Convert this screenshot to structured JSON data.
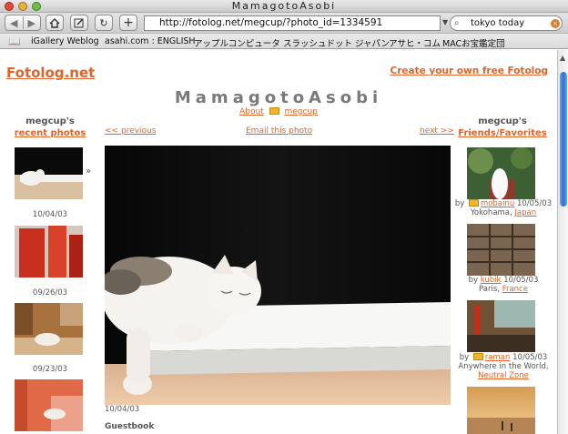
{
  "window": {
    "title": "MamagotoAsobi"
  },
  "toolbar": {
    "url": "http://fotolog.net/megcup/?photo_id=1334591",
    "search_value": "tokyo today"
  },
  "bookmarks": [
    "iGallery Weblog",
    "asahi.com : ENGLISH",
    "アップルコンピュータ",
    "スラッシュドット ジャパン",
    "アサヒ・コム",
    "MACお宝鑑定団"
  ],
  "header": {
    "logo": "Fotolog.net",
    "create_link": "Create your own free Fotolog",
    "page_title": "MamagotoAsobi",
    "about_link": "About",
    "user_link": "megcup"
  },
  "left_column": {
    "owner": "megcup's",
    "title_link": "recent photos",
    "current_marker": "»",
    "dates": [
      "10/04/03",
      "09/26/03",
      "09/23/03"
    ]
  },
  "nav": {
    "prev": "<< previous",
    "email": "Email this photo",
    "next": "next >>"
  },
  "photo": {
    "date": "10/04/03",
    "guestbook": "Guestbook"
  },
  "right_column": {
    "owner": "megcup's",
    "title_link": "Friends/Favorites",
    "favorites": [
      {
        "by": "by",
        "user": "mobainu",
        "date": "10/05/03",
        "place": "Yokohama, ",
        "country": "Japan"
      },
      {
        "by": "by",
        "user": "kubik",
        "date": "10/05/03",
        "place": "Paris, ",
        "country": "France"
      },
      {
        "by": "by",
        "user": "raman",
        "date": "10/05/03",
        "place": "Anywhere in the World, ",
        "country": "Neutral Zone"
      }
    ]
  },
  "colors": {
    "link": "#e0642a",
    "title_gray": "#7a7a7a",
    "scroll_blue": "#2e6fd0"
  }
}
